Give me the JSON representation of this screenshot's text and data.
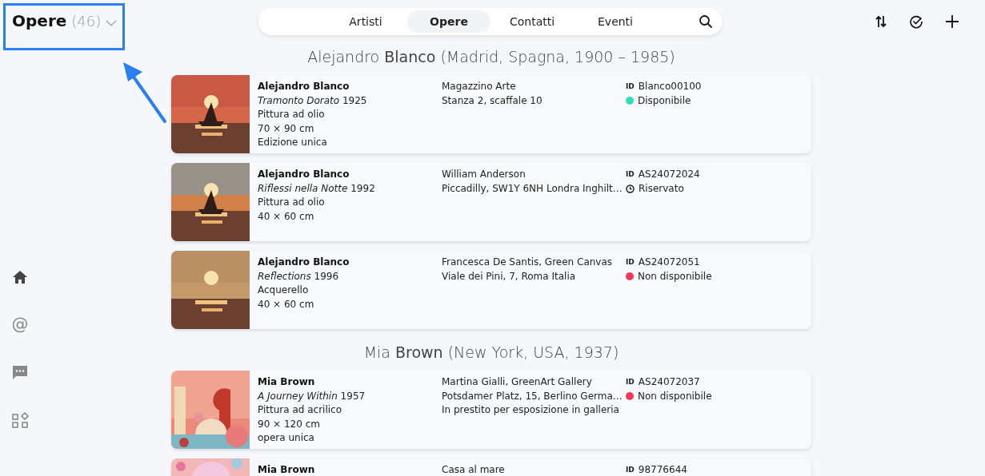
{
  "header": {
    "title": "Opere",
    "count": "(46)"
  },
  "nav": {
    "tabs": [
      {
        "label": "Artisti",
        "selected": false
      },
      {
        "label": "Opere",
        "selected": true
      },
      {
        "label": "Contatti",
        "selected": false
      },
      {
        "label": "Eventi",
        "selected": false
      }
    ]
  },
  "sidebar": {
    "items": [
      {
        "kind": "home",
        "selected": true
      },
      {
        "kind": "at",
        "glyph": "@",
        "selected": false
      },
      {
        "kind": "chat",
        "selected": false
      },
      {
        "kind": "apps",
        "selected": false
      }
    ]
  },
  "groups": [
    {
      "heading": "Alejandro **Blanco** (Madrid, Spagna, 1900 – 1985)",
      "works": [
        {
          "artist": "Alejandro Blanco",
          "title": "*Tramonto Dorato* 1925",
          "details": [
            "Pittura ad olio",
            "70 × 90 cm",
            "Edizione unica"
          ],
          "location": [
            "Magazzino Arte",
            "Stanza 2, scaffale 10"
          ],
          "id_label": "ID",
          "id": "Blanco00100",
          "status": {
            "kind": "dot",
            "color": "#2de0b9",
            "label": "Disponibile"
          }
        },
        {
          "artist": "Alejandro Blanco",
          "title": "*Riflessi nella Notte* 1992",
          "details": [
            "Pittura ad olio",
            "40 × 60 cm"
          ],
          "location": [
            "William Anderson",
            "Piccadilly, SW1Y 6NH Londra Inghilt…"
          ],
          "id_label": "ID",
          "id": "AS24072024",
          "status": {
            "kind": "clock",
            "label": "Riservato"
          }
        },
        {
          "artist": "Alejandro Blanco",
          "title": "*Reflections* 1996",
          "details": [
            "Acquerello",
            "40 × 60 cm"
          ],
          "location": [
            "Francesca De Santis, Green Canvas",
            "Viale dei Pini, 7, Roma Italia"
          ],
          "id_label": "ID",
          "id": "AS24072051",
          "status": {
            "kind": "dot",
            "color": "#f5385a",
            "label": "Non disponibile"
          }
        }
      ]
    },
    {
      "heading": "Mia **Brown** (New York, USA, 1937)",
      "works": [
        {
          "artist": "Mia Brown",
          "title": "*A Journey Within* 1957",
          "details": [
            "Pittura ad acrilico",
            "90 × 120 cm",
            "opera unica"
          ],
          "location": [
            "Martina Gialli, GreenArt Gallery",
            "Potsdamer Platz, 15, Berlino Germa…",
            "In prestito per esposizione in galleria"
          ],
          "id_label": "ID",
          "id": "AS24072037",
          "status": {
            "kind": "dot",
            "color": "#f5385a",
            "label": "Non disponibile"
          }
        },
        {
          "artist": "Mia Brown",
          "location": [
            "Casa al mare"
          ],
          "id_label": "ID",
          "id": "98776644"
        }
      ]
    }
  ]
}
